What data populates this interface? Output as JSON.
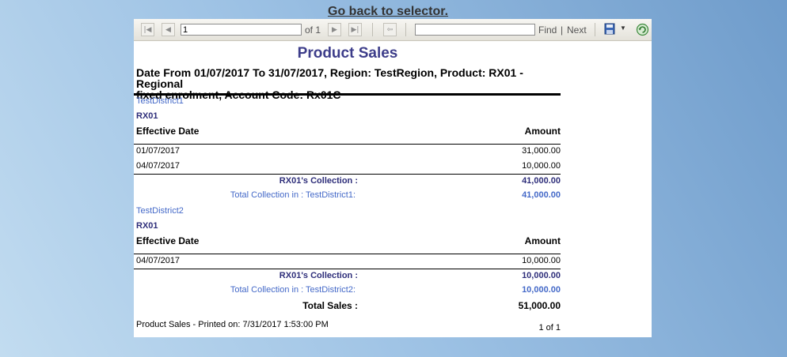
{
  "back_link": "Go back to selector.",
  "toolbar": {
    "page_value": "1",
    "of_label": "of 1",
    "search_value": "",
    "find_label": "Find",
    "separator": "|",
    "next_label": "Next"
  },
  "report": {
    "title": "Product Sales",
    "subtitle_line1": "Date From 01/07/2017 To 31/07/2017, Region: TestRegion, Product: RX01 - Regional",
    "subtitle_line2": "fixed enrolment, Account Code: Rx01C",
    "col_date": "Effective Date",
    "col_amount": "Amount",
    "groups": [
      {
        "district": "TestDistrict1",
        "product": "RX01",
        "rows": [
          {
            "date": "01/07/2017",
            "amount": "31,000.00"
          },
          {
            "date": "04/07/2017",
            "amount": "10,000.00"
          }
        ],
        "collection_label": "RX01's  Collection :",
        "collection_value": "41,000.00",
        "total_label": "Total Collection in : TestDistrict1:",
        "total_value": "41,000.00"
      },
      {
        "district": "TestDistrict2",
        "product": "RX01",
        "rows": [
          {
            "date": "04/07/2017",
            "amount": "10,000.00"
          }
        ],
        "collection_label": "RX01's  Collection :",
        "collection_value": "10,000.00",
        "total_label": "Total Collection in : TestDistrict2:",
        "total_value": "10,000.00"
      }
    ],
    "grand_total_label": "Total Sales :",
    "grand_total_value": "51,000.00",
    "footer_printed": "Product Sales - Printed on: 7/31/2017 1:53:00 PM",
    "footer_page": "1 of 1"
  },
  "icons": {
    "first": "first-page-icon",
    "prev": "previous-page-icon",
    "next": "next-page-icon",
    "last": "last-page-icon",
    "back": "back-to-parent-icon",
    "save": "save-export-icon",
    "refresh": "refresh-icon"
  }
}
